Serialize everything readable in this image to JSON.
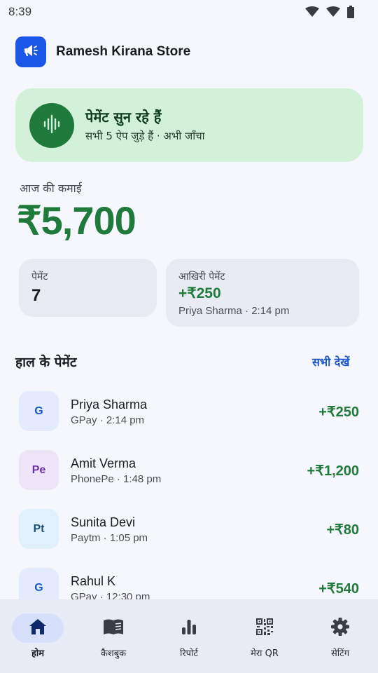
{
  "status_bar": {
    "time": "8:39",
    "icons": [
      "wifi-icon",
      "wifi-icon",
      "battery-icon"
    ]
  },
  "header": {
    "title": "Ramesh Kirana Store",
    "logo_icon": "megaphone-icon"
  },
  "listening_card": {
    "title": "पेमेंट सुन रहे हैं",
    "subtitle": "सभी 5 ऐप जुड़े हैं · अभी जाँचा",
    "icon": "soundwave-icon"
  },
  "earnings": {
    "label": "आज की कमाई",
    "amount": "₹5,700"
  },
  "stats": {
    "payments_label": "पेमेंट",
    "payments_count": "7",
    "last_label": "आखिरी पेमेंट",
    "last_amount": "+₹250",
    "last_meta": "Priya Sharma · 2:14 pm"
  },
  "recent": {
    "title": "हाल के पेमेंट",
    "see_all": "सभी देखें",
    "items": [
      {
        "initials": "G",
        "name": "Priya Sharma",
        "meta": "GPay · 2:14 pm",
        "amount": "+₹250"
      },
      {
        "initials": "Pe",
        "name": "Amit Verma",
        "meta": "PhonePe · 1:48 pm",
        "amount": "+₹1,200"
      },
      {
        "initials": "Pt",
        "name": "Sunita Devi",
        "meta": "Paytm · 1:05 pm",
        "amount": "+₹80"
      },
      {
        "initials": "G",
        "name": "Rahul K",
        "meta": "GPay · 12:30 pm",
        "amount": "+₹540"
      }
    ]
  },
  "nav": {
    "items": [
      {
        "label": "होम",
        "icon": "home-icon",
        "active": true
      },
      {
        "label": "कैशबुक",
        "icon": "book-icon",
        "active": false
      },
      {
        "label": "रिपोर्ट",
        "icon": "bar-chart-icon",
        "active": false
      },
      {
        "label": "मेरा QR",
        "icon": "qr-code-icon",
        "active": false
      },
      {
        "label": "सेटिंग",
        "icon": "gear-icon",
        "active": false
      }
    ]
  },
  "colors": {
    "accent_green": "#1f7a3c",
    "card_green": "#d3f1d8",
    "brand_blue": "#1a56e8",
    "link_blue": "#1a56c8",
    "avatar_gpay_bg": "#e3ebfd",
    "avatar_phonepe_bg": "#eee4f8",
    "avatar_paytm_bg": "#e0f1fb"
  }
}
